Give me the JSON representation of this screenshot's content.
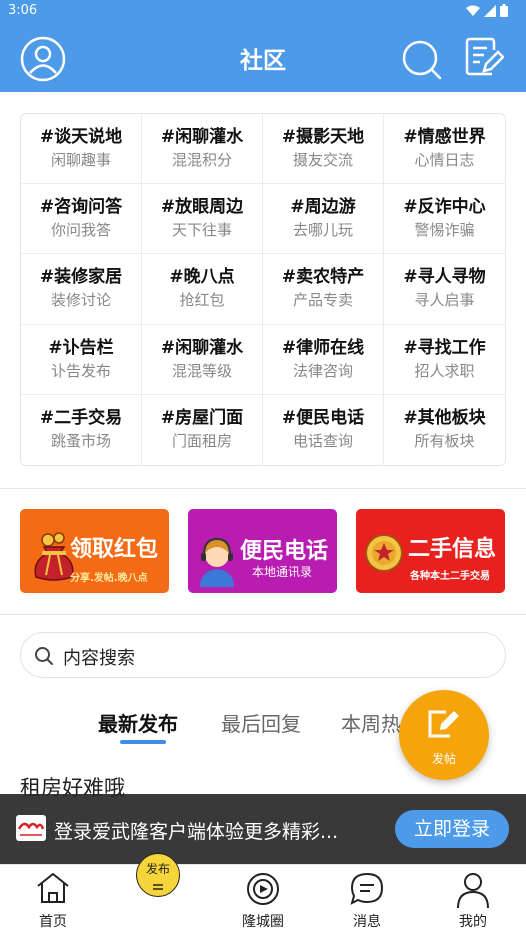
{
  "status_bar": {
    "time": "3:06"
  },
  "header": {
    "title": "社区"
  },
  "boards": [
    {
      "title": "#谈天说地",
      "sub": "闲聊趣事"
    },
    {
      "title": "#闲聊灌水",
      "sub": "混混积分"
    },
    {
      "title": "#摄影天地",
      "sub": "摄友交流"
    },
    {
      "title": "#情感世界",
      "sub": "心情日志"
    },
    {
      "title": "#咨询问答",
      "sub": "你问我答"
    },
    {
      "title": "#放眼周边",
      "sub": "天下往事"
    },
    {
      "title": "#周边游",
      "sub": "去哪儿玩"
    },
    {
      "title": "#反诈中心",
      "sub": "警惕诈骗"
    },
    {
      "title": "#装修家居",
      "sub": "装修讨论"
    },
    {
      "title": "#晚八点",
      "sub": "抢红包"
    },
    {
      "title": "#卖农特产",
      "sub": "产品专卖"
    },
    {
      "title": "#寻人寻物",
      "sub": "寻人启事"
    },
    {
      "title": "#讣告栏",
      "sub": "讣告发布"
    },
    {
      "title": "#闲聊灌水",
      "sub": "混混等级"
    },
    {
      "title": "#律师在线",
      "sub": "法律咨询"
    },
    {
      "title": "#寻找工作",
      "sub": "招人求职"
    },
    {
      "title": "#二手交易",
      "sub": "跳蚤市场"
    },
    {
      "title": "#房屋门面",
      "sub": "门面租房"
    },
    {
      "title": "#便民电话",
      "sub": "电话查询"
    },
    {
      "title": "#其他板块",
      "sub": "所有板块"
    }
  ],
  "banners": {
    "red_packet": {
      "title": "领取红包",
      "sub": "分享.发帖.晚八点",
      "color": "#f46a15"
    },
    "phone": {
      "title": "便民电话",
      "sub": "本地通讯录",
      "color": "#b81cb0"
    },
    "secondhand": {
      "title": "二手信息",
      "sub": "各种本土二手交易",
      "color": "#e8201e"
    }
  },
  "search": {
    "placeholder": "内容搜索"
  },
  "tabs": [
    {
      "label": "最新发布",
      "active": true
    },
    {
      "label": "最后回复",
      "active": false
    },
    {
      "label": "本周热",
      "active": false
    }
  ],
  "fab": {
    "label": "发帖"
  },
  "post": {
    "title": "租房好难哦"
  },
  "toast": {
    "message": "登录爱武隆客户端体验更多精彩...",
    "button": "立即登录"
  },
  "publish_button": {
    "label": "发布"
  },
  "bottom_nav": [
    {
      "label": "首页",
      "icon": "home-icon"
    },
    {
      "label": "隆城圈",
      "icon": "circle-icon"
    },
    {
      "label": "消息",
      "icon": "message-icon"
    },
    {
      "label": "我的",
      "icon": "person-icon"
    }
  ],
  "colors": {
    "primary": "#4d9be8",
    "accent": "#f5a50b"
  }
}
